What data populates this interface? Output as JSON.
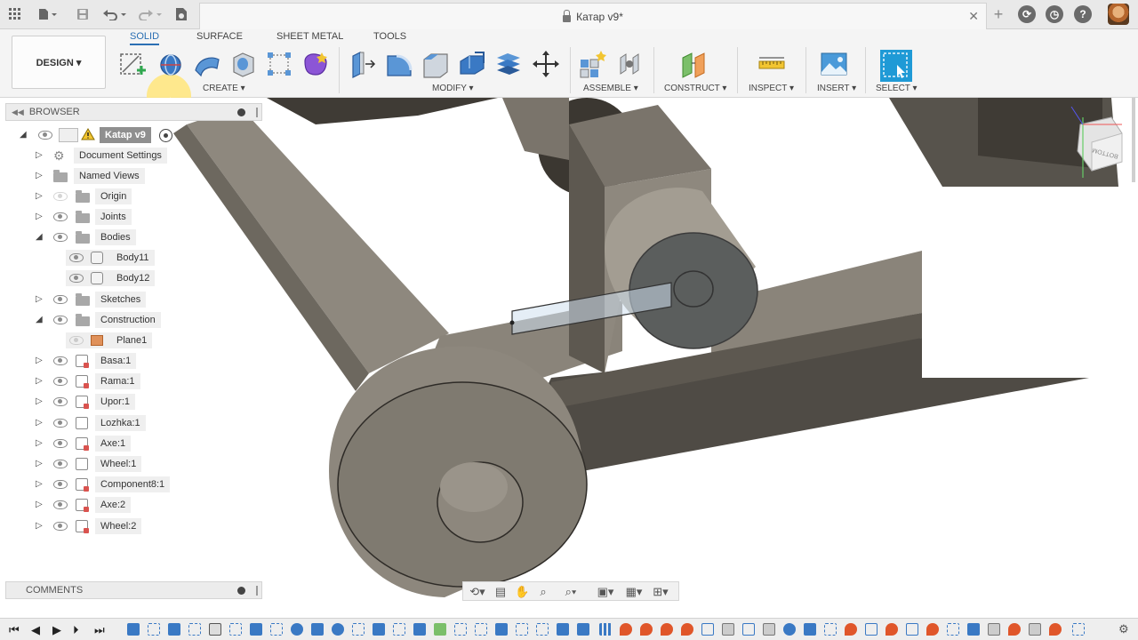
{
  "window": {
    "title": "Катар v9*"
  },
  "toolbar": {
    "design_label": "DESIGN ▾",
    "tabs": [
      "SOLID",
      "SURFACE",
      "SHEET METAL",
      "TOOLS"
    ],
    "groups": [
      "CREATE ▾",
      "MODIFY ▾",
      "ASSEMBLE ▾",
      "CONSTRUCT ▾",
      "INSPECT ▾",
      "INSERT ▾",
      "SELECT ▾"
    ]
  },
  "browser": {
    "header": "BROWSER",
    "root": "Katap v9",
    "items": [
      {
        "label": "Document Settings",
        "icon": "gear-icon"
      },
      {
        "label": "Named Views",
        "icon": "folder-icon"
      },
      {
        "label": "Origin",
        "icon": "folder-icon"
      },
      {
        "label": "Joints",
        "icon": "folder-icon"
      },
      {
        "label": "Bodies",
        "icon": "folder-icon"
      },
      {
        "label": "Body11",
        "icon": "body-icon"
      },
      {
        "label": "Body12",
        "icon": "body-icon"
      },
      {
        "label": "Sketches",
        "icon": "folder-icon"
      },
      {
        "label": "Construction",
        "icon": "folder-icon"
      },
      {
        "label": "Plane1",
        "icon": "plane-icon"
      },
      {
        "label": "Basa:1",
        "icon": "component-icon"
      },
      {
        "label": "Rama:1",
        "icon": "component-icon"
      },
      {
        "label": "Upor:1",
        "icon": "component-icon"
      },
      {
        "label": "Lozhka:1",
        "icon": "component-icon"
      },
      {
        "label": "Axe:1",
        "icon": "component-icon"
      },
      {
        "label": "Wheel:1",
        "icon": "component-icon"
      },
      {
        "label": "Component8:1",
        "icon": "component-icon"
      },
      {
        "label": "Axe:2",
        "icon": "component-icon"
      },
      {
        "label": "Wheel:2",
        "icon": "component-icon"
      }
    ]
  },
  "comments": {
    "header": "COMMENTS"
  },
  "viewcube": {
    "face_label": "BOTTOM"
  },
  "colors": {
    "accent": "#2b6fb3",
    "model_dark": "#4a4640",
    "model_light": "#8a847a",
    "highlight": "#ffe57a"
  }
}
